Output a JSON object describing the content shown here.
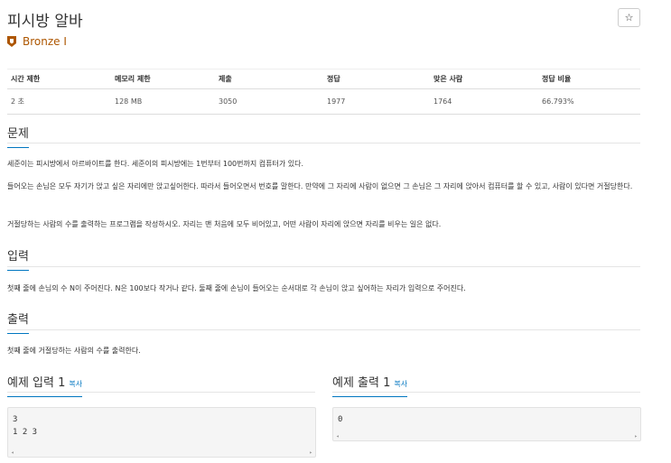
{
  "problem": {
    "title": "피시방 알바",
    "star": "☆",
    "tier": "Bronze I"
  },
  "stats": {
    "headers": [
      "시간 제한",
      "메모리 제한",
      "제출",
      "정답",
      "맞은 사람",
      "정답 비율"
    ],
    "values": [
      "2 초",
      "128 MB",
      "3050",
      "1977",
      "1764",
      "66.793%"
    ]
  },
  "sections": {
    "description": {
      "heading": "문제",
      "paragraphs": [
        "세준이는 피시방에서 아르바이트를 한다. 세준이의 피시방에는 1번부터 100번까지 컴퓨터가 있다.",
        "들어오는 손님은 모두 자기가 앉고 싶은 자리에만 앉고싶어한다. 따라서 들어오면서 번호를 말한다. 만약에 그 자리에 사람이 없으면 그 손님은 그 자리에 앉아서 컴퓨터를 할 수 있고, 사람이 있다면 거절당한다.",
        "거절당하는 사람의 수를 출력하는 프로그램을 작성하시오. 자리는 맨 처음에 모두 비어있고, 어떤 사람이 자리에 앉으면 자리를 비우는 일은 없다."
      ]
    },
    "input": {
      "heading": "입력",
      "text": "첫째 줄에 손님의 수 N이 주어진다. N은 100보다 작거나 같다. 둘째 줄에 손님이 들어오는 순서대로 각 손님이 앉고 싶어하는 자리가 입력으로 주어진다."
    },
    "output": {
      "heading": "출력",
      "text": "첫째 줄에 거절당하는 사람의 수를 출력한다."
    }
  },
  "samples": {
    "input_title": "예제 입력 1",
    "output_title": "예제 출력 1",
    "copy_label": "복사",
    "input_text": "3\n1 2 3",
    "output_text": "0"
  },
  "colors": {
    "tier": "#ad5600",
    "accent": "#0076c0"
  }
}
